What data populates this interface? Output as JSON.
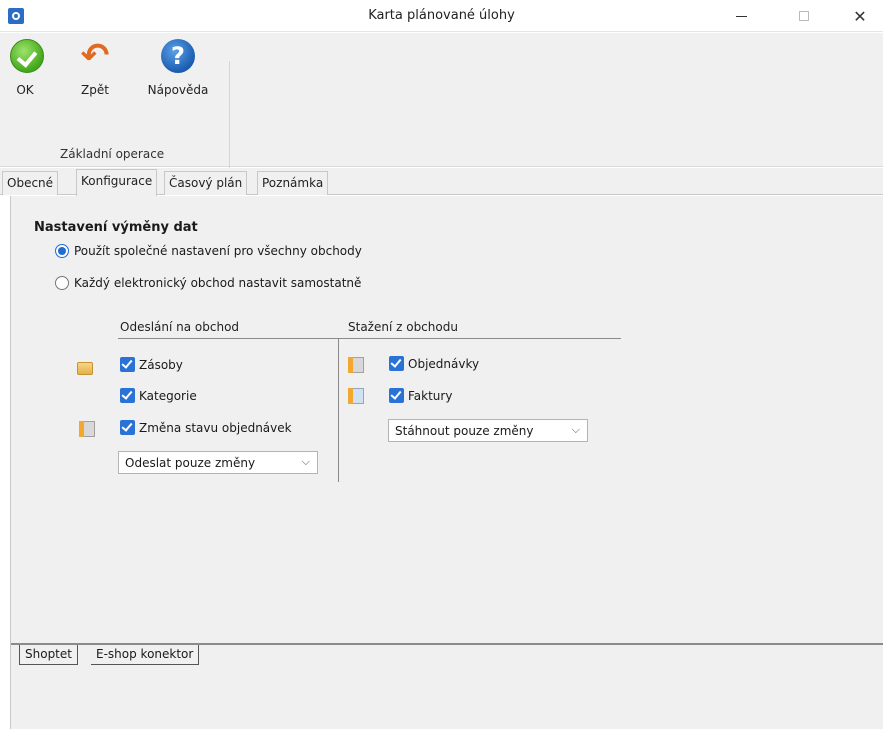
{
  "window": {
    "title": "Karta plánované úlohy",
    "minimize_glyph": "—",
    "close_glyph": "✕"
  },
  "ribbon": {
    "ok_label": "OK",
    "back_label": "Zpět",
    "help_label": "Nápověda",
    "group_label": "Základní operace",
    "help_glyph": "?",
    "back_glyph": "↶"
  },
  "tabs": [
    {
      "label": "Obecné"
    },
    {
      "label": "Konfigurace"
    },
    {
      "label": "Časový plán"
    },
    {
      "label": "Poznámka"
    }
  ],
  "config": {
    "section_title": "Nastavení výměny dat",
    "radio_shared": "Použít společné nastavení pro všechny obchody",
    "radio_separate": "Každý elektronický obchod nastavit samostatně",
    "send": {
      "header": "Odeslání na obchod",
      "items": [
        "Zásoby",
        "Kategorie",
        "Změna stavu objednávek"
      ],
      "dropdown": "Odeslat pouze změny"
    },
    "download": {
      "header": "Stažení z obchodu",
      "items": [
        "Objednávky",
        "Faktury"
      ],
      "dropdown": "Stáhnout pouze změny"
    }
  },
  "subtabs": [
    {
      "label": "Shoptet"
    },
    {
      "label": "E-shop konektor"
    }
  ]
}
